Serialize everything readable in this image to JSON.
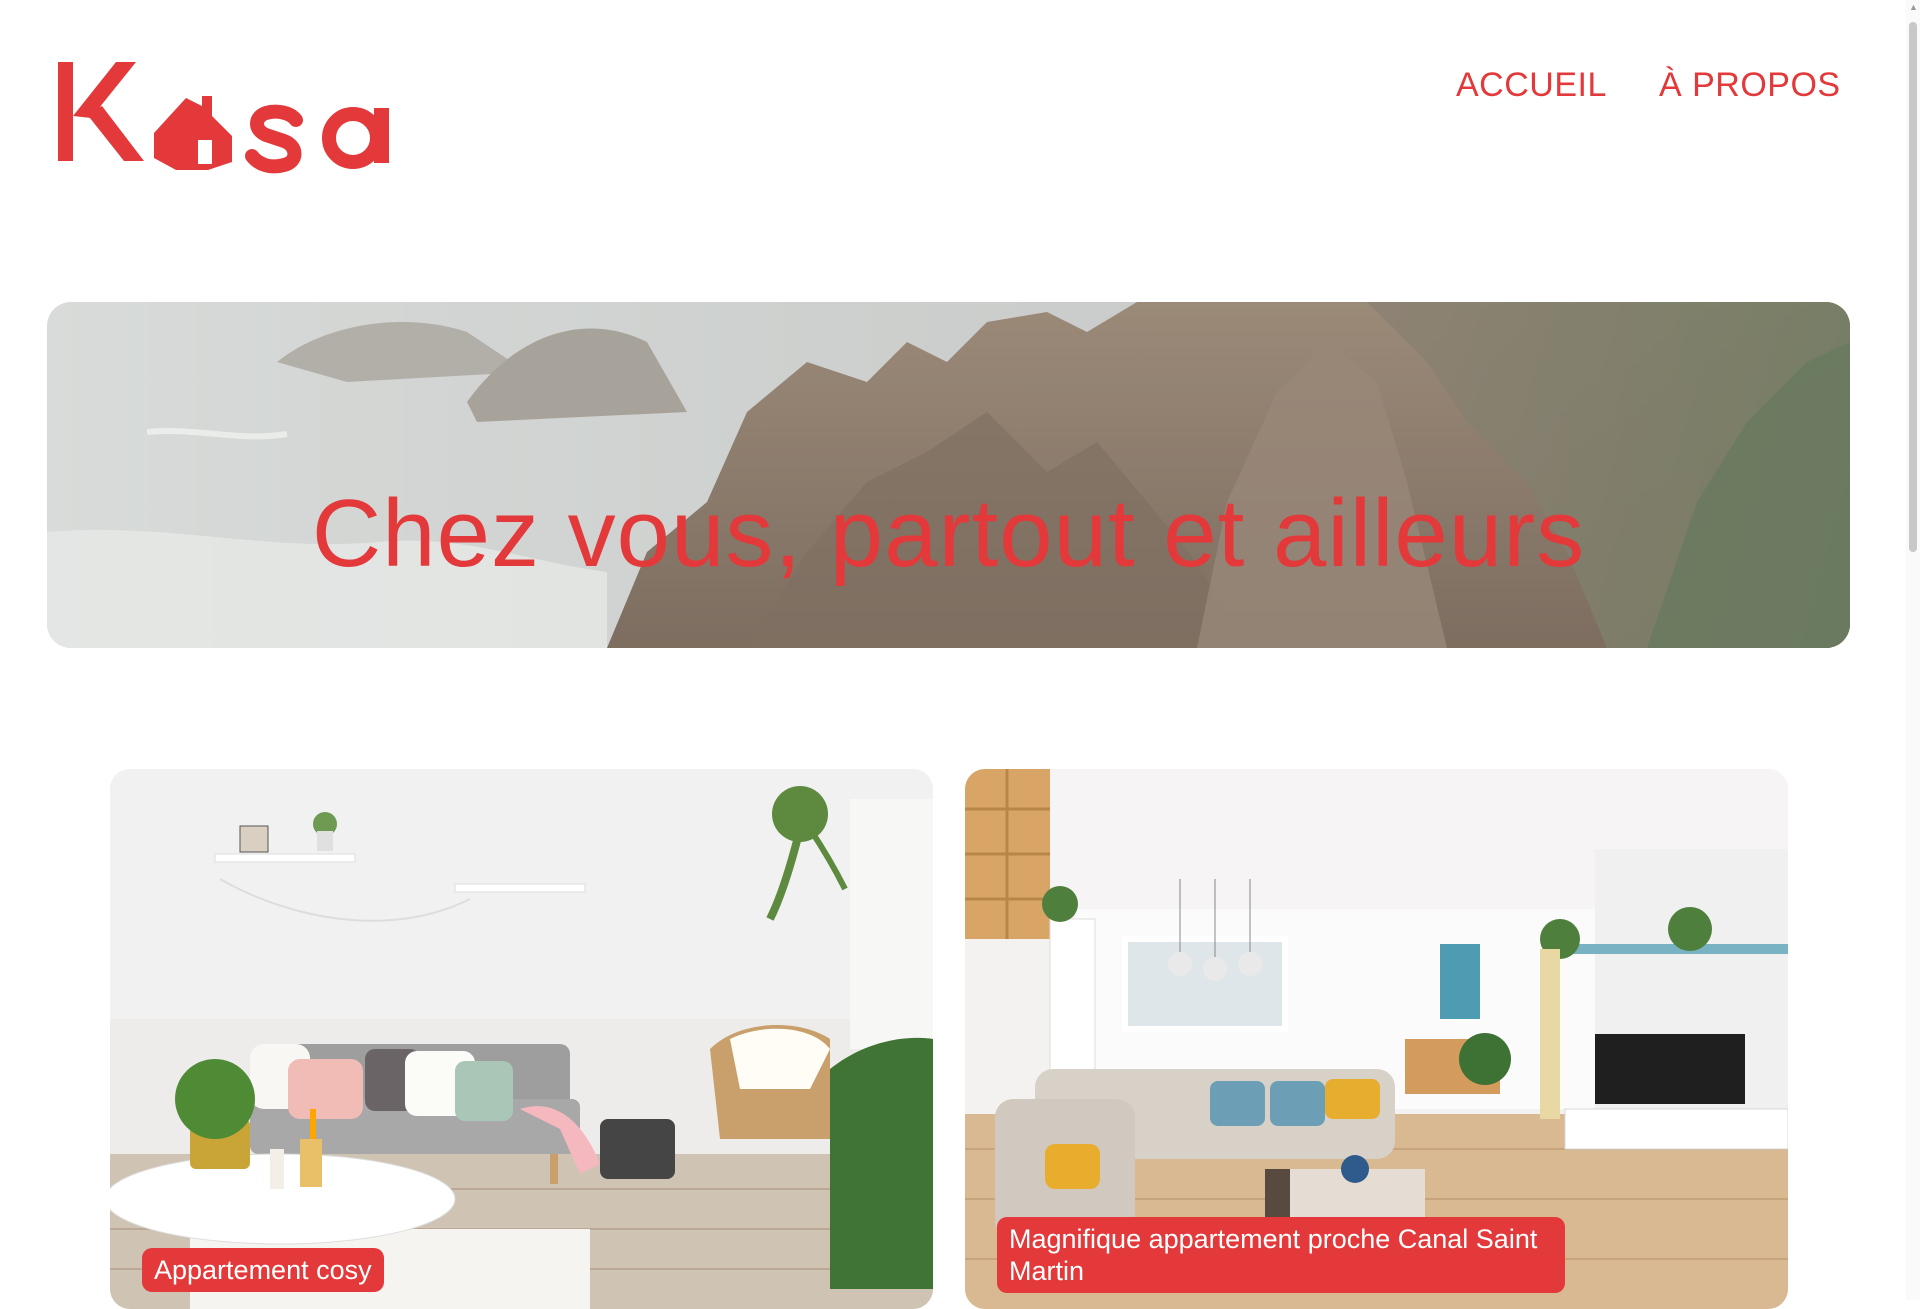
{
  "header": {
    "logo_text": "Kasa",
    "nav": {
      "home_label": "ACCUEIL",
      "about_label": "À PROPOS"
    }
  },
  "banner": {
    "title": "Chez vous, partout et ailleurs",
    "image": "coastal-cliffs-photo"
  },
  "listings": [
    {
      "title": "Appartement cosy",
      "image": "living-room-photo"
    },
    {
      "title": "Magnifique appartement proche Canal Saint Martin",
      "image": "living-room-photo-2"
    }
  ],
  "colors": {
    "brand": "#E3393B",
    "background": "#FFFFFF",
    "label_text": "#FFFFFF"
  },
  "scrollbar": {
    "icon": "scroll-up-arrow-icon"
  }
}
